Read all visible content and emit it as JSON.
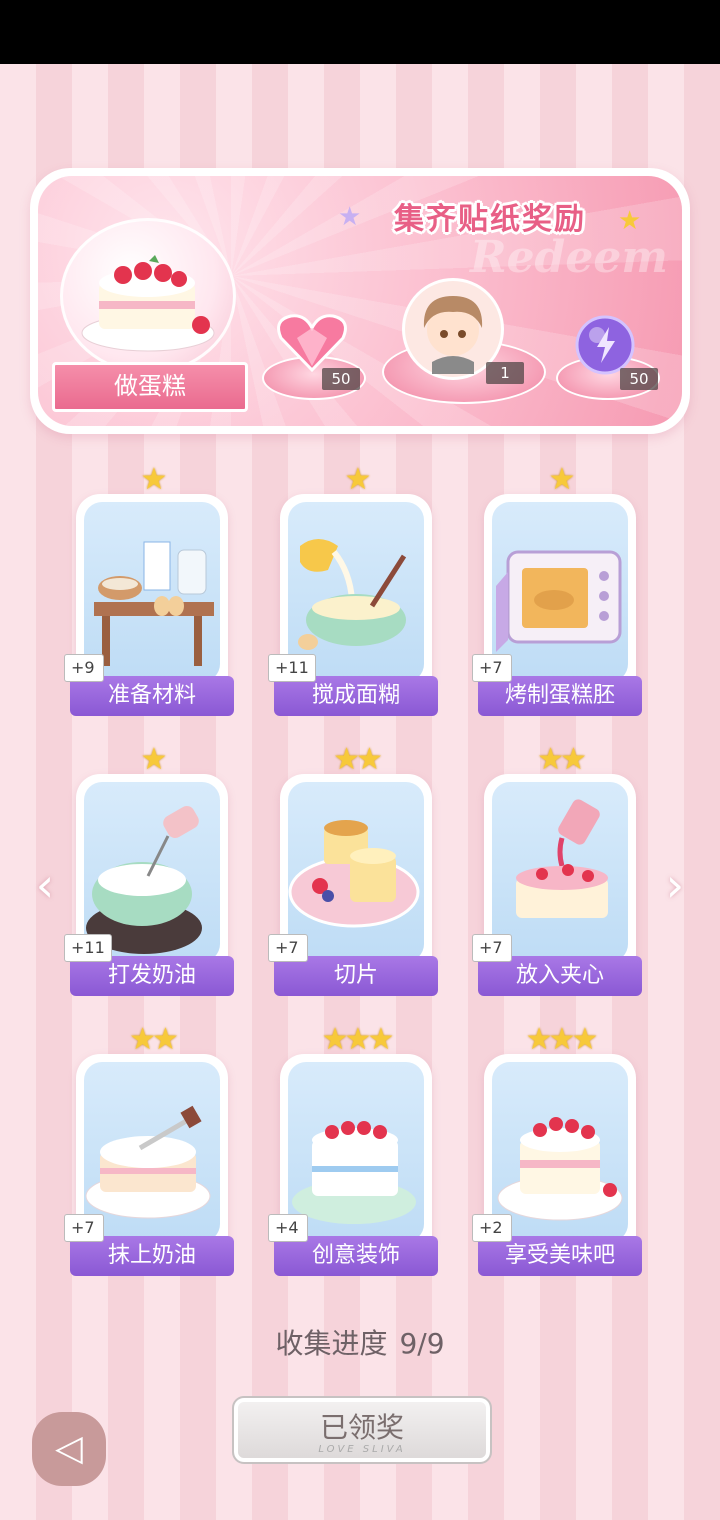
{
  "header": {
    "title": "集齐贴纸奖励",
    "watermark": "Redeem",
    "cake_label": "做蛋糕",
    "rewards": [
      {
        "icon": "pink-heart-gem-icon",
        "count": "50"
      },
      {
        "icon": "chibi-avatar-sticker",
        "count": "1"
      },
      {
        "icon": "purple-lightning-orb-icon",
        "count": "50"
      }
    ]
  },
  "steps": [
    {
      "label": "准备材料",
      "bonus": "+9",
      "stars": "★"
    },
    {
      "label": "搅成面糊",
      "bonus": "+11",
      "stars": "★"
    },
    {
      "label": "烤制蛋糕胚",
      "bonus": "+7",
      "stars": "★"
    },
    {
      "label": "打发奶油",
      "bonus": "+11",
      "stars": "★"
    },
    {
      "label": "切片",
      "bonus": "+7",
      "stars": "★★"
    },
    {
      "label": "放入夹心",
      "bonus": "+7",
      "stars": "★★"
    },
    {
      "label": "抹上奶油",
      "bonus": "+7",
      "stars": "★★"
    },
    {
      "label": "创意装饰",
      "bonus": "+4",
      "stars": "★★★"
    },
    {
      "label": "享受美味吧",
      "bonus": "+2",
      "stars": "★★★"
    }
  ],
  "progress": {
    "label": "收集进度",
    "value": "9/9"
  },
  "claim_button": {
    "label": "已领奖",
    "sub": "LOVE SLIVA"
  },
  "nav": {
    "prev": "‹",
    "next": "›"
  },
  "colors": {
    "accent_pink": "#e85f86",
    "card_label_purple": "#9a68dc",
    "star_gold": "#f7c93a"
  }
}
